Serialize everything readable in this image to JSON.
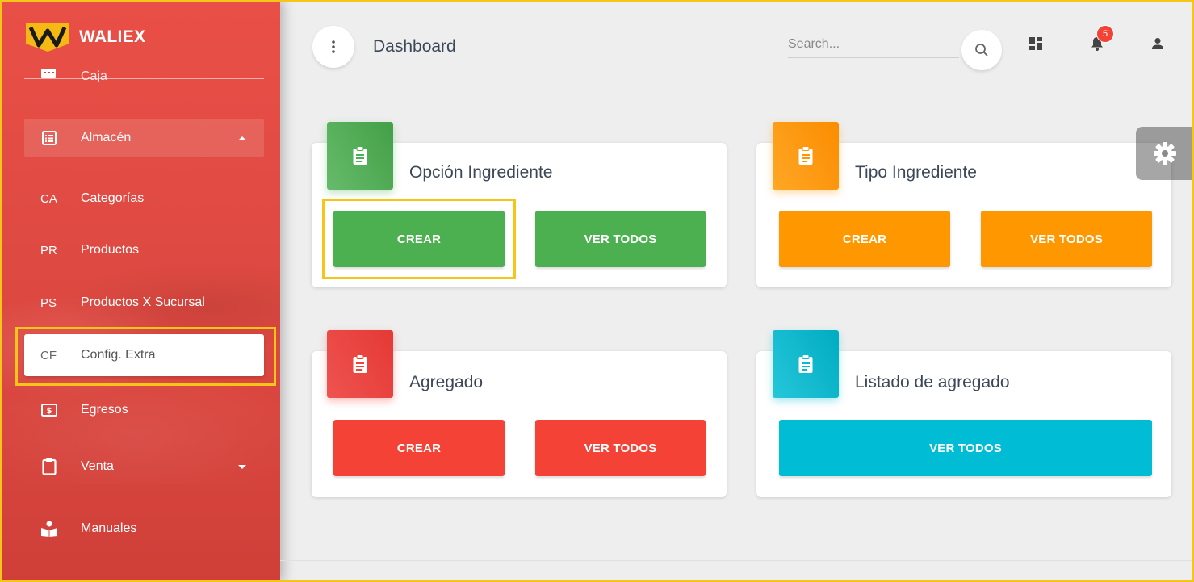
{
  "brand": {
    "name": "WALIEX"
  },
  "sidebar": {
    "partial_item": {
      "label": "Caja"
    },
    "items": [
      {
        "type": "icon",
        "icon": "list-alt-icon",
        "label": "Almacén",
        "state": "expanded"
      },
      {
        "type": "abbr",
        "abbr": "CA",
        "label": "Categorías"
      },
      {
        "type": "abbr",
        "abbr": "PR",
        "label": "Productos"
      },
      {
        "type": "abbr",
        "abbr": "PS",
        "label": "Productos X Sucursal"
      },
      {
        "type": "abbr",
        "abbr": "CF",
        "label": "Config. Extra",
        "state": "active"
      },
      {
        "type": "icon",
        "icon": "money-icon",
        "label": "Egresos"
      },
      {
        "type": "icon",
        "icon": "clipboard-icon",
        "label": "Venta",
        "state": "collapsed"
      },
      {
        "type": "icon",
        "icon": "book-reader-icon",
        "label": "Manuales"
      }
    ]
  },
  "header": {
    "title": "Dashboard",
    "search": {
      "placeholder": "Search...",
      "value": ""
    },
    "notifications": {
      "count": "5"
    }
  },
  "cards": [
    {
      "title": "Opción Ingrediente",
      "color": "#4caf50",
      "create_label": "CREAR",
      "view_label": "VER TODOS"
    },
    {
      "title": "Tipo Ingrediente",
      "color": "#ff9800",
      "create_label": "CREAR",
      "view_label": "VER TODOS"
    },
    {
      "title": "Agregado",
      "color": "#f44336",
      "create_label": "CREAR",
      "view_label": "VER TODOS"
    },
    {
      "title": "Listado de agregado",
      "color": "#00bcd4",
      "view_label": "VER TODOS"
    }
  ],
  "colors": {
    "sidebar": "#e53935",
    "highlight": "#f5c518"
  }
}
